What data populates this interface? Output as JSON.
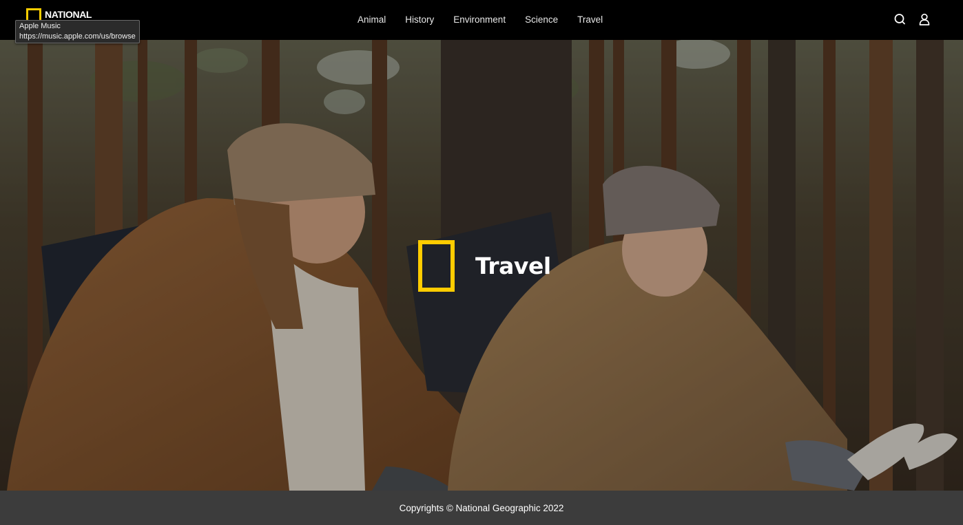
{
  "header": {
    "logo_text": "NATIONAL",
    "nav": [
      "Animal",
      "History",
      "Environment",
      "Science",
      "Travel"
    ],
    "icons": [
      "search-icon",
      "user-icon"
    ]
  },
  "tooltip": {
    "title": "Apple Music",
    "url": "https://music.apple.com/us/browse"
  },
  "hero": {
    "title": "Travel"
  },
  "footer": {
    "copyright": "Copyrights © National Geographic 2022"
  },
  "colors": {
    "brand_yellow": "#ffcc00",
    "header_bg": "#000000",
    "footer_bg": "#3c3c3c"
  }
}
